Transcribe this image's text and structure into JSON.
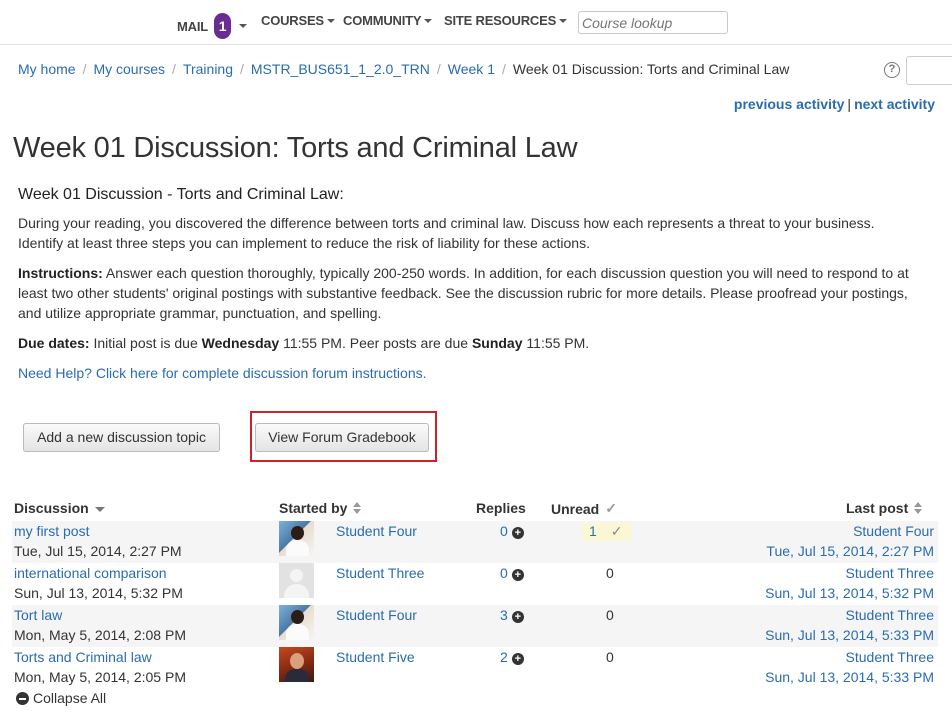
{
  "nav": {
    "mail": "MAIL",
    "mail_count": "1",
    "courses": "COURSES",
    "community": "COMMUNITY",
    "site_resources": "SITE RESOURCES",
    "course_lookup_placeholder": "Course lookup"
  },
  "breadcrumb": {
    "items": [
      "My home",
      "My courses",
      "Training",
      "MSTR_BUS651_1_2.0_TRN",
      "Week 1"
    ],
    "current": "Week 01 Discussion: Torts and Criminal Law"
  },
  "activity_nav": {
    "previous": "previous activity",
    "separator": "|",
    "next": "next activity"
  },
  "page_title": "Week 01 Discussion: Torts and Criminal Law",
  "intro": {
    "heading": "Week 01 Discussion - Torts and Criminal Law:",
    "paragraph": "During your reading, you discovered the difference between torts and criminal law. Discuss how each represents a threat to your business. Identify at least three steps you can implement to reduce the risk of liability for these actions.",
    "instructions_label": "Instructions:",
    "instructions_text": " Answer each question thoroughly, typically 200-250 words. In addition, for each discussion question you will need to respond to at least two other students' original postings with substantive feedback. See the discussion rubric for more details. Please proofread your postings, and utilize appropriate grammar, punctuation, and spelling.",
    "due_label": "Due dates:",
    "due_text_1": " Initial post is due ",
    "due_day_1": "Wednesday",
    "due_text_2": " 11:55 PM. Peer posts are due ",
    "due_day_2": "Sunday",
    "due_text_3": " 11:55 PM.",
    "help_link": "Need Help? Click here for complete discussion forum instructions."
  },
  "buttons": {
    "add_topic": "Add a new discussion topic",
    "gradebook": "View Forum Gradebook"
  },
  "table": {
    "headers": {
      "discussion": "Discussion",
      "started_by": "Started by",
      "replies": "Replies",
      "unread": "Unread",
      "last_post": "Last post"
    },
    "rows": [
      {
        "title": "my first post",
        "date": "Tue, Jul 15, 2014, 2:27 PM",
        "author": "Student Four",
        "replies": "0",
        "unread": "1",
        "last_author": "Student Four",
        "last_date": "Tue, Jul 15, 2014, 2:27 PM"
      },
      {
        "title": "international comparison",
        "date": "Sun, Jul 13, 2014, 5:32 PM",
        "author": "Student Three",
        "replies": "0",
        "unread": "0",
        "last_author": "Student Three",
        "last_date": "Sun, Jul 13, 2014, 5:32 PM"
      },
      {
        "title": "Tort law",
        "date": "Mon, May 5, 2014, 2:08 PM",
        "author": "Student Four",
        "replies": "3",
        "unread": "0",
        "last_author": "Student Three",
        "last_date": "Sun, Jul 13, 2014, 5:33 PM"
      },
      {
        "title": "Torts and Criminal law",
        "date": "Mon, May 5, 2014, 2:05 PM",
        "author": "Student Five",
        "replies": "2",
        "unread": "0",
        "last_author": "Student Three",
        "last_date": "Sun, Jul 13, 2014, 5:33 PM"
      }
    ],
    "collapse_all": "Collapse All"
  }
}
